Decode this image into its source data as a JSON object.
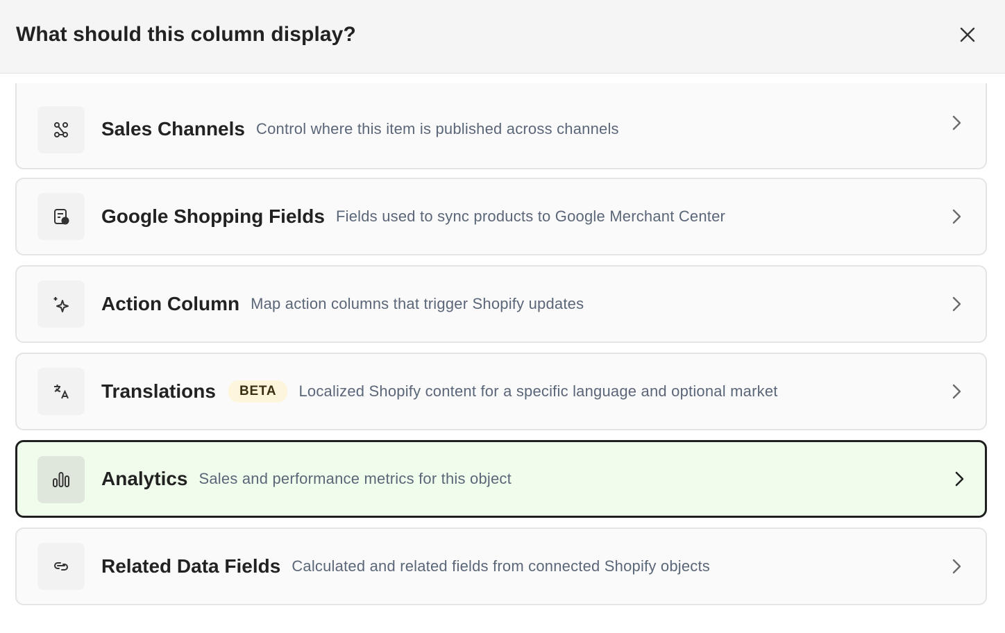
{
  "header": {
    "title": "What should this column display?"
  },
  "rows": [
    {
      "icon": "sales-channels-icon",
      "title": "Sales Channels",
      "description": "Control where this item is published across channels",
      "badge": ""
    },
    {
      "icon": "google-shopping-icon",
      "title": "Google Shopping Fields",
      "description": "Fields used to sync products to Google Merchant Center",
      "badge": ""
    },
    {
      "icon": "sparkle-icon",
      "title": "Action Column",
      "description": "Map action columns that trigger Shopify updates",
      "badge": ""
    },
    {
      "icon": "translate-icon",
      "title": "Translations",
      "description": "Localized Shopify content for a specific language and optional market",
      "badge": "BETA"
    },
    {
      "icon": "bar-chart-icon",
      "title": "Analytics",
      "description": "Sales and performance metrics for this object",
      "badge": "",
      "selected": true
    },
    {
      "icon": "link-icon",
      "title": "Related Data Fields",
      "description": "Calculated and related fields from connected Shopify objects",
      "badge": ""
    }
  ],
  "colors": {
    "selected_border": "#1f1f1f",
    "selected_bg": "#f0fdec",
    "badge_bg": "#fdf6dd",
    "description": "#5b6678"
  }
}
